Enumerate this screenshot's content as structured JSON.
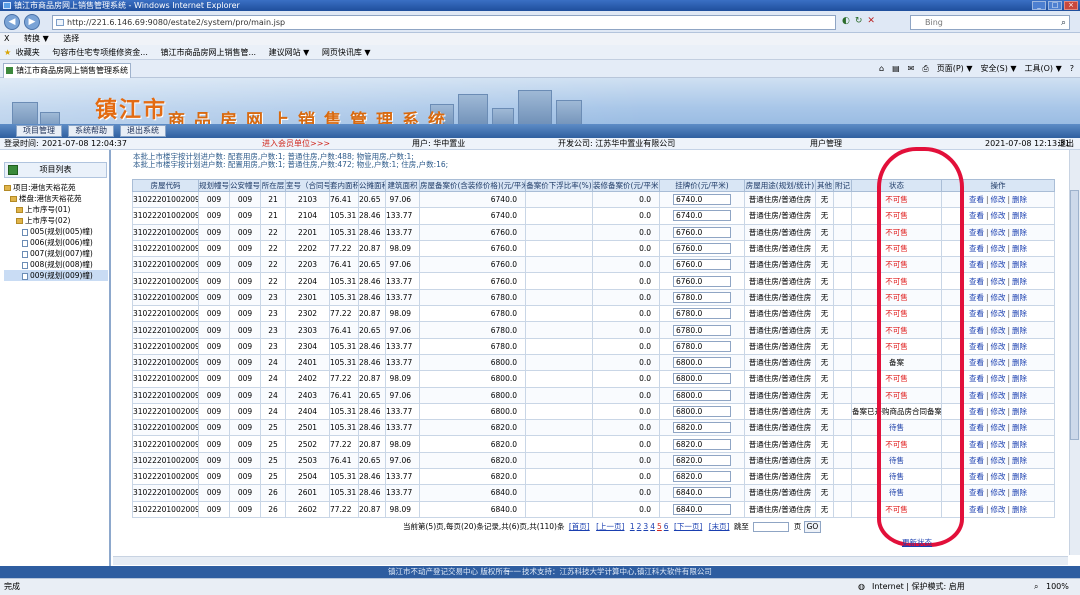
{
  "window": {
    "title": "镇江市商品房网上销售管理系统 - Windows Internet Explorer"
  },
  "browser": {
    "address": "http://221.6.146.69:9080/estate2/system/pro/main.jsp",
    "search_placeholder": "Bing",
    "menu": [
      "X",
      "转换 ▼",
      "选择"
    ],
    "favorites_label": "收藏夹",
    "favorites": [
      "句容市住宅专项维修资金...",
      "镇江市商品房网上销售管...",
      "建议网站 ▼",
      "网页快讯库 ▼"
    ],
    "tab_title": "镇江市商品房网上销售管理系统",
    "commands": [
      "页面(P) ▼",
      "安全(S) ▼",
      "工具(O) ▼"
    ]
  },
  "banner": {
    "city": "镇江市",
    "system": "商品房网上销售管理系统",
    "menu": [
      "项目管理",
      "系统帮助",
      "退出系统"
    ]
  },
  "status_strip": {
    "login_time_label": "登录时间:",
    "login_time": "2021-07-08 12:04:37",
    "member_link": "进入会员单位>>>",
    "user": "用户: 华中置业",
    "developer": "开发公司: 江苏华中置业有限公司",
    "user_mgmt": "用户管理",
    "now": "2021-07-08 12:13:31",
    "logout": "退出"
  },
  "left_panel": {
    "title": "项目列表",
    "tree": [
      {
        "label": "项目:港信天裕花苑",
        "indent": 0,
        "icon": "folder"
      },
      {
        "label": "楼盘:港信天裕花苑",
        "indent": 1,
        "icon": "folder"
      },
      {
        "label": "上市序号(01)",
        "indent": 2,
        "icon": "folder"
      },
      {
        "label": "上市序号(02)",
        "indent": 2,
        "icon": "folder"
      },
      {
        "label": "005(规划(005)幢)",
        "indent": 3,
        "icon": "doc"
      },
      {
        "label": "006(规划(006)幢)",
        "indent": 3,
        "icon": "doc"
      },
      {
        "label": "007(规划(007)幢)",
        "indent": 3,
        "icon": "doc"
      },
      {
        "label": "008(规划(008)幢)",
        "indent": 3,
        "icon": "doc"
      },
      {
        "label": "009(规划(009)幢)",
        "indent": 3,
        "icon": "doc",
        "selected": true
      }
    ]
  },
  "stats": [
    "本批上市楼宇按计划进户数: 配套用房,户数:1; 普通住房,户数:488; 物管用房,户数:1;",
    "本批上市楼宇按计划进户数: 配置用房,户数:1; 普通住房,户数:472; 物业,户数:1; 住房,户数:16;"
  ],
  "table": {
    "headers": [
      "房屋代码",
      "规划幢号",
      "公安幢号",
      "所在层",
      "室号（合同号）",
      "套内面积",
      "公摊面积",
      "建筑面积",
      "房屋备案价(含装修价格)(元/平米)",
      "备案价下浮比率(%)",
      "装修备案价(元/平米)",
      "挂牌价(元/平米)",
      "房屋用途(规划/统计)",
      "其他",
      "附记",
      "状态",
      "操作"
    ],
    "actions": [
      "查看",
      "修改",
      "删除"
    ],
    "rows": [
      [
        "310222010020092103",
        "009",
        "009",
        "21",
        "2103",
        "76.41",
        "20.65",
        "97.06",
        "6740.0",
        "",
        "0.0",
        "6740.0",
        "普通住房/普通住房",
        "无",
        "",
        "不可售"
      ],
      [
        "310222010020092104",
        "009",
        "009",
        "21",
        "2104",
        "105.31",
        "28.46",
        "133.77",
        "6740.0",
        "",
        "0.0",
        "6740.0",
        "普通住房/普通住房",
        "无",
        "",
        "不可售"
      ],
      [
        "310222010020092201",
        "009",
        "009",
        "22",
        "2201",
        "105.31",
        "28.46",
        "133.77",
        "6760.0",
        "",
        "0.0",
        "6760.0",
        "普通住房/普通住房",
        "无",
        "",
        "不可售"
      ],
      [
        "310222010020092202",
        "009",
        "009",
        "22",
        "2202",
        "77.22",
        "20.87",
        "98.09",
        "6760.0",
        "",
        "0.0",
        "6760.0",
        "普通住房/普通住房",
        "无",
        "",
        "不可售"
      ],
      [
        "310222010020092203",
        "009",
        "009",
        "22",
        "2203",
        "76.41",
        "20.65",
        "97.06",
        "6760.0",
        "",
        "0.0",
        "6760.0",
        "普通住房/普通住房",
        "无",
        "",
        "不可售"
      ],
      [
        "310222010020092204",
        "009",
        "009",
        "22",
        "2204",
        "105.31",
        "28.46",
        "133.77",
        "6760.0",
        "",
        "0.0",
        "6760.0",
        "普通住房/普通住房",
        "无",
        "",
        "不可售"
      ],
      [
        "310222010020092301",
        "009",
        "009",
        "23",
        "2301",
        "105.31",
        "28.46",
        "133.77",
        "6780.0",
        "",
        "0.0",
        "6780.0",
        "普通住房/普通住房",
        "无",
        "",
        "不可售"
      ],
      [
        "310222010020092302",
        "009",
        "009",
        "23",
        "2302",
        "77.22",
        "20.87",
        "98.09",
        "6780.0",
        "",
        "0.0",
        "6780.0",
        "普通住房/普通住房",
        "无",
        "",
        "不可售"
      ],
      [
        "310222010020092303",
        "009",
        "009",
        "23",
        "2303",
        "76.41",
        "20.65",
        "97.06",
        "6780.0",
        "",
        "0.0",
        "6780.0",
        "普通住房/普通住房",
        "无",
        "",
        "不可售"
      ],
      [
        "310222010020092304",
        "009",
        "009",
        "23",
        "2304",
        "105.31",
        "28.46",
        "133.77",
        "6780.0",
        "",
        "0.0",
        "6780.0",
        "普通住房/普通住房",
        "无",
        "",
        "不可售"
      ],
      [
        "310222010020092401",
        "009",
        "009",
        "24",
        "2401",
        "105.31",
        "28.46",
        "133.77",
        "6800.0",
        "",
        "0.0",
        "6800.0",
        "普通住房/普通住房",
        "无",
        "",
        "备案"
      ],
      [
        "310222010020092402",
        "009",
        "009",
        "24",
        "2402",
        "77.22",
        "20.87",
        "98.09",
        "6800.0",
        "",
        "0.0",
        "6800.0",
        "普通住房/普通住房",
        "无",
        "",
        "不可售"
      ],
      [
        "310222010020092403",
        "009",
        "009",
        "24",
        "2403",
        "76.41",
        "20.65",
        "97.06",
        "6800.0",
        "",
        "0.0",
        "6800.0",
        "普通住房/普通住房",
        "无",
        "",
        "不可售"
      ],
      [
        "310222010020092404",
        "009",
        "009",
        "24",
        "2404",
        "105.31",
        "28.46",
        "133.77",
        "6800.0",
        "",
        "0.0",
        "6800.0",
        "普通住房/普通住房",
        "无",
        "",
        "备案已开购商品房合同备案"
      ],
      [
        "310222010020092501",
        "009",
        "009",
        "25",
        "2501",
        "105.31",
        "28.46",
        "133.77",
        "6820.0",
        "",
        "0.0",
        "6820.0",
        "普通住房/普通住房",
        "无",
        "",
        "待售"
      ],
      [
        "310222010020092502",
        "009",
        "009",
        "25",
        "2502",
        "77.22",
        "20.87",
        "98.09",
        "6820.0",
        "",
        "0.0",
        "6820.0",
        "普通住房/普通住房",
        "无",
        "",
        "不可售"
      ],
      [
        "310222010020092503",
        "009",
        "009",
        "25",
        "2503",
        "76.41",
        "20.65",
        "97.06",
        "6820.0",
        "",
        "0.0",
        "6820.0",
        "普通住房/普通住房",
        "无",
        "",
        "待售"
      ],
      [
        "310222010020092504",
        "009",
        "009",
        "25",
        "2504",
        "105.31",
        "28.46",
        "133.77",
        "6820.0",
        "",
        "0.0",
        "6820.0",
        "普通住房/普通住房",
        "无",
        "",
        "待售"
      ],
      [
        "310222010020092601",
        "009",
        "009",
        "26",
        "2601",
        "105.31",
        "28.46",
        "133.77",
        "6840.0",
        "",
        "0.0",
        "6840.0",
        "普通住房/普通住房",
        "无",
        "",
        "待售"
      ],
      [
        "310222010020092602",
        "009",
        "009",
        "26",
        "2602",
        "77.22",
        "20.87",
        "98.09",
        "6840.0",
        "",
        "0.0",
        "6840.0",
        "普通住房/普通住房",
        "无",
        "",
        "不可售"
      ]
    ],
    "status_colors": {
      "不可售": "#e02020",
      "备案": "#000000",
      "待售": "#1c3fa8",
      "备案已开购商品房合同备案": "#000000"
    }
  },
  "pager": {
    "summary": "当前第(5)页,每页(20)条记录,共(6)页,共(110)条",
    "first": "[首页]",
    "prev": "[上一页]",
    "pages": [
      "1",
      "2",
      "3",
      "4",
      "5",
      "6"
    ],
    "current_page": "5",
    "next": "[下一页]",
    "last": "[末页]",
    "goto_label": "跳至",
    "page_unit": "页",
    "go": "GO"
  },
  "partial_link": "更新状态",
  "footer": {
    "left": "镇江市不动产登记交易中心 版权所有",
    "sep": "一一",
    "support": "技术支持：江苏科技大学计算中心,镇江科大软件有限公司"
  },
  "statusbar": {
    "left": "完成",
    "zone": "Internet | 保护模式: 启用",
    "zoom": "100%"
  },
  "annotation": {
    "color": "#e2103a"
  }
}
